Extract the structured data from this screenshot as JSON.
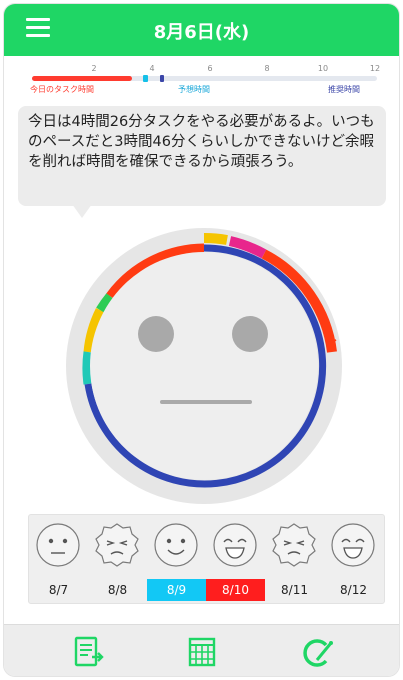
{
  "header": {
    "title": "8月6日(水)",
    "menu_icon": "menu-icon",
    "color": "#1fd665"
  },
  "time_scale": {
    "ticks": [
      "2",
      "4",
      "6",
      "8",
      "10",
      "12"
    ],
    "task_label": "今日のタスク時間",
    "forecast_label": "予想時間",
    "recommended_label": "推奨時間",
    "task_hours": 3.5,
    "colors": {
      "task": "#ff3b2f",
      "forecast": "#15c0e8",
      "recommended": "#3b46a8"
    }
  },
  "message": "今日は4時間26分タスクをやる必要があるよ。いつものペースだと3時間46分くらいしかできないけど余暇を削れば時間を確保できるから頑張ろう。",
  "clock_face": {
    "expression": "neutral",
    "face_icon": "neutral-face-icon"
  },
  "days": [
    {
      "label": "8/7",
      "face": "neutral-face-icon",
      "highlight": ""
    },
    {
      "label": "8/8",
      "face": "tired-face-icon",
      "highlight": ""
    },
    {
      "label": "8/9",
      "face": "smile-face-icon",
      "highlight": "#12c8f5"
    },
    {
      "label": "8/10",
      "face": "grin-face-icon",
      "highlight": "#ff1e1e"
    },
    {
      "label": "8/11",
      "face": "tired-face-icon",
      "highlight": ""
    },
    {
      "label": "8/12",
      "face": "grin-face-icon",
      "highlight": ""
    }
  ],
  "bottom_nav": {
    "items": [
      "task-list-icon",
      "calendar-icon",
      "settings-icon"
    ],
    "color": "#1fd665"
  }
}
